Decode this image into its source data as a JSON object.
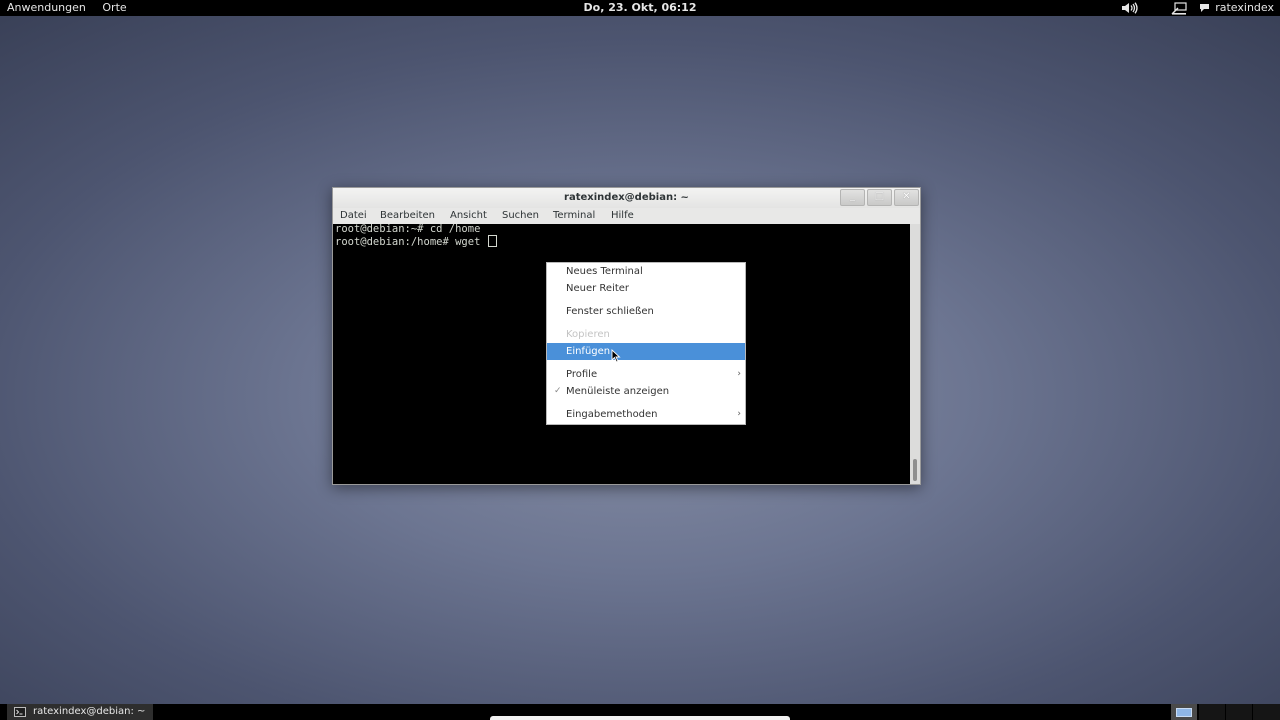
{
  "top_panel": {
    "applications": "Anwendungen",
    "places": "Orte",
    "clock": "Do, 23. Okt, 06:12",
    "volume_icon": "speaker-icon",
    "accessibility_icon": "accessibility-icon",
    "chat_icon": "chat-bubble-icon",
    "user": "ratexindex"
  },
  "window": {
    "title": "ratexindex@debian: ~",
    "buttons": {
      "minimize": "_",
      "maximize": "□",
      "close": "✕"
    },
    "menu": [
      "Datei",
      "Bearbeiten",
      "Ansicht",
      "Suchen",
      "Terminal",
      "Hilfe"
    ],
    "terminal_lines": [
      "root@debian:~# cd /home",
      "root@debian:/home# wget "
    ]
  },
  "context_menu": {
    "items": [
      {
        "label": "Neues Terminal",
        "state": "normal"
      },
      {
        "label": "Neuer Reiter",
        "state": "normal"
      },
      {
        "label": "Fenster schließen",
        "state": "normal"
      },
      {
        "label": "Kopieren",
        "state": "disabled"
      },
      {
        "label": "Einfügen",
        "state": "highlighted"
      },
      {
        "label": "Profile",
        "state": "submenu"
      },
      {
        "label": "Menüleiste anzeigen",
        "state": "checked"
      },
      {
        "label": "Eingabemethoden",
        "state": "submenu"
      }
    ],
    "submenu_arrow": "›",
    "check_mark": "✓"
  },
  "bottom_panel": {
    "task_label": "ratexindex@debian: ~",
    "task_icon": "terminal-icon"
  },
  "colors": {
    "menu_highlight": "#4a90d9",
    "terminal_bg": "#000000",
    "panel_bg": "#000000"
  }
}
